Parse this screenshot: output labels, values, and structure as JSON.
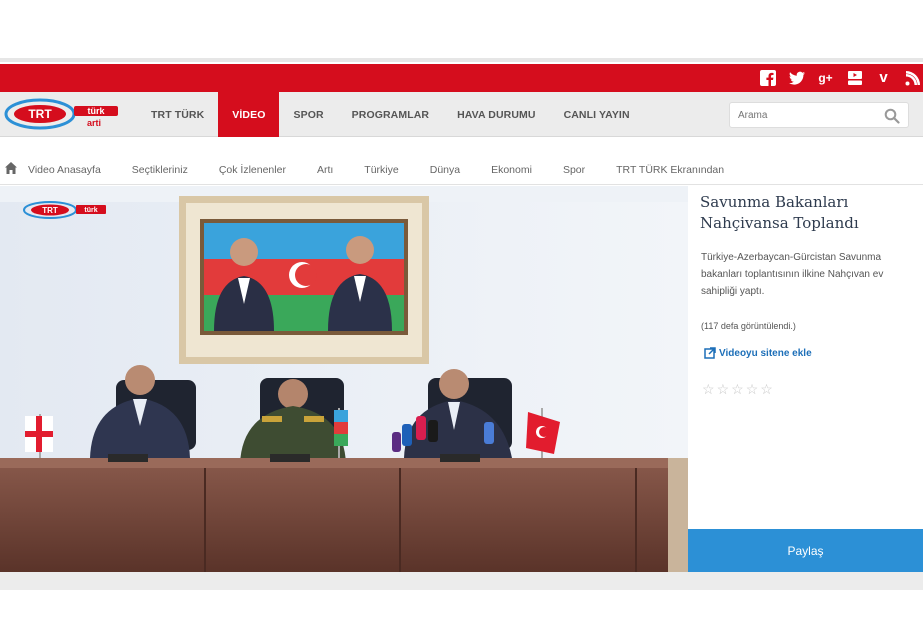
{
  "social": {
    "icons": [
      "facebook-icon",
      "twitter-icon",
      "google-plus-icon",
      "youtube-icon",
      "vimeo-icon",
      "rss-icon"
    ]
  },
  "brand": {
    "logo_text": "TRT",
    "logo_subtext": "türk",
    "logo_subtext2": "arti",
    "colors": {
      "red": "#d50d1d",
      "blue": "#2c90d6",
      "nav_bg": "#ececec"
    }
  },
  "nav": {
    "items": [
      "TRT TÜRK",
      "VİDEO",
      "SPOR",
      "PROGRAMLAR",
      "HAVA DURUMU",
      "CANLI YAYIN"
    ],
    "active": "VİDEO",
    "search_placeholder": "Arama"
  },
  "subnav": {
    "items": [
      "Video Anasayfa",
      "Seçtikleriniz",
      "Çok İzlenenler",
      "Artı",
      "Türkiye",
      "Dünya",
      "Ekonomi",
      "Spor",
      "TRT TÜRK Ekranından"
    ]
  },
  "video": {
    "channel_logo_text": "TRT",
    "channel_logo_subtext": "türk"
  },
  "panel": {
    "title": "Savunma Bakanları Nahçivansa Toplandı",
    "description": "Türkiye-Azerbaycan-Gürcistan Savunma bakanları toplantısının ilkine Nahçıvan ev sahipliği yaptı.",
    "views": "(117 defa görüntülendi.)",
    "embed_label": "Videoyu sitene ekle",
    "rating": 0,
    "rating_max": 5,
    "share_label": "Paylaş"
  }
}
